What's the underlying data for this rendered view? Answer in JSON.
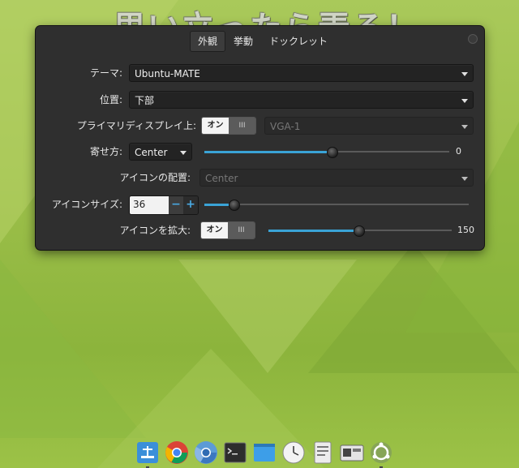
{
  "watermark": "思い立ったら弄る！",
  "tabs": [
    {
      "label": "外観",
      "active": true
    },
    {
      "label": "挙動",
      "active": false
    },
    {
      "label": "ドックレット",
      "active": false
    }
  ],
  "settings": {
    "theme": {
      "label": "テーマ:",
      "value": "Ubuntu-MATE"
    },
    "position": {
      "label": "位置:",
      "value": "下部"
    },
    "primary_display": {
      "label": "プライマリディスプレイ上:",
      "toggle_on": "オン",
      "toggle_off": "III",
      "value": "VGA-1"
    },
    "alignment": {
      "label": "寄せ方:",
      "value": "Center",
      "slider_value": "0",
      "slider_fraction": 0.52
    },
    "icon_placement": {
      "label": "アイコンの配置:",
      "value": "Center"
    },
    "icon_size": {
      "label": "アイコンサイズ:",
      "value": "36",
      "minus": "−",
      "plus": "+",
      "slider_fraction": 0.11
    },
    "zoom": {
      "label": "アイコンを拡大:",
      "toggle_on": "オン",
      "toggle_off": "III",
      "value": "150",
      "slider_fraction": 0.49
    }
  },
  "dock": {
    "items": [
      "network-icon",
      "chrome-icon",
      "chromium-icon",
      "terminal-icon",
      "window-icon",
      "clock-icon",
      "text-editor-icon",
      "screenshot-icon",
      "ubuntu-mate-icon"
    ]
  },
  "colors": {
    "accent": "#3aa3d6",
    "window_bg": "#2f2f2f",
    "desktop_green": "#9cbf4a"
  }
}
